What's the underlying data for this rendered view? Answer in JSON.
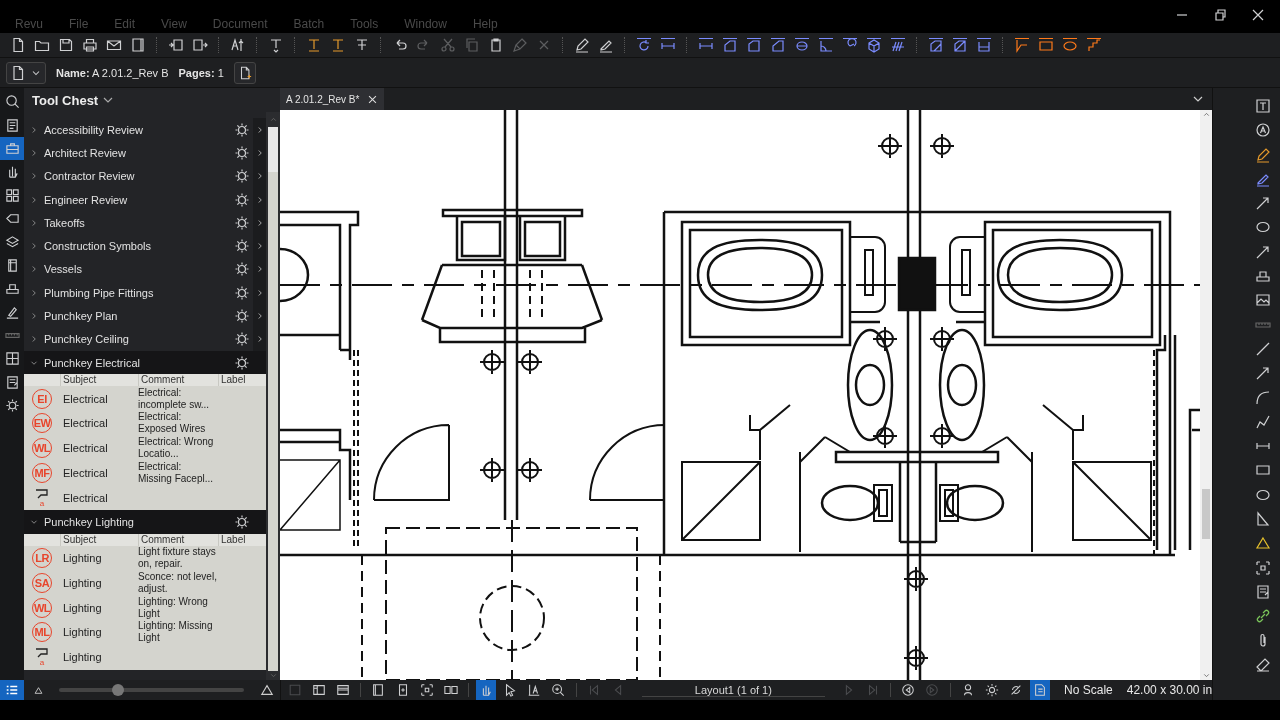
{
  "menu": [
    "Revu",
    "File",
    "Edit",
    "View",
    "Document",
    "Batch",
    "Tools",
    "Window",
    "Help"
  ],
  "toolbar": [
    {
      "tools": [
        {
          "disabled": false
        },
        {
          "disabled": false
        },
        {
          "disabled": false
        },
        {
          "disabled": false
        },
        {
          "disabled": false
        },
        {
          "disabled": false
        }
      ]
    },
    {
      "tools": [
        {
          "disabled": false
        },
        {
          "disabled": false
        }
      ]
    },
    {
      "tools": [
        {
          "disabled": false
        }
      ]
    },
    {
      "tools": [
        {
          "disabled": false
        }
      ]
    },
    {
      "tools": [
        {
          "disabled": false
        },
        {
          "disabled": false
        },
        {
          "disabled": false
        }
      ]
    },
    {
      "tools": [
        {
          "disabled": false
        },
        {
          "disabled": true
        },
        {
          "disabled": true
        },
        {
          "disabled": true
        },
        {
          "disabled": false
        },
        {
          "disabled": true
        },
        {
          "disabled": true
        }
      ]
    },
    {
      "tools": [
        {
          "disabled": false
        },
        {
          "disabled": false
        }
      ]
    },
    {
      "tools": [
        {
          "disabled": false
        },
        {
          "disabled": false
        }
      ]
    },
    {
      "tools": [
        {
          "disabled": false
        },
        {
          "disabled": false
        },
        {
          "disabled": false
        },
        {
          "disabled": false
        },
        {
          "disabled": false
        },
        {
          "disabled": false
        },
        {
          "disabled": false
        },
        {
          "disabled": false
        },
        {
          "disabled": false
        }
      ]
    },
    {
      "tools": [
        {
          "disabled": false
        },
        {
          "disabled": false
        },
        {
          "disabled": false
        }
      ]
    },
    {
      "tools": [
        {
          "disabled": false
        },
        {
          "disabled": false
        },
        {
          "disabled": false
        },
        {
          "disabled": false
        }
      ]
    }
  ],
  "properties_bar": {
    "name_label": "Name:",
    "name": "A 2.01.2_Rev B",
    "pages_label": "Pages:",
    "pages": "1"
  },
  "left_rail": [
    {
      "selected": false
    },
    {
      "selected": false
    },
    {
      "selected": true
    },
    {
      "selected": false
    },
    {
      "selected": false
    },
    {
      "selected": false
    },
    {
      "selected": false
    },
    {
      "selected": false
    },
    {
      "selected": false
    },
    {
      "selected": false
    },
    {
      "selected": false
    },
    {
      "selected": false
    },
    {
      "selected": false
    },
    {
      "selected": false
    }
  ],
  "tool_chest": {
    "title": "Tool Chest",
    "collections": [
      {
        "name": "Accessibility Review",
        "expanded": false
      },
      {
        "name": "Architect Review",
        "expanded": false
      },
      {
        "name": "Contractor Review",
        "expanded": false
      },
      {
        "name": "Engineer Review",
        "expanded": false
      },
      {
        "name": "Takeoffs",
        "expanded": false
      },
      {
        "name": "Construction Symbols",
        "expanded": false
      },
      {
        "name": "Vessels",
        "expanded": false
      },
      {
        "name": "Plumbing Pipe Fittings",
        "expanded": false
      },
      {
        "name": "Punchkey Plan",
        "expanded": false
      },
      {
        "name": "Punchkey Ceiling",
        "expanded": false
      },
      {
        "name": "Punchkey Electrical",
        "expanded": true,
        "columns": [
          "Subject",
          "Comment",
          "Label"
        ],
        "tools": [
          {
            "kind": "stamp",
            "symbol": "EI",
            "subject": "Electrical",
            "comment": "Electrical: incomplete sw..."
          },
          {
            "kind": "stamp",
            "symbol": "EW",
            "subject": "Electrical",
            "comment": "Electrical: Exposed Wires"
          },
          {
            "kind": "stamp",
            "symbol": "WL",
            "subject": "Electrical",
            "comment": "Electrical: Wrong Locatio..."
          },
          {
            "kind": "stamp",
            "symbol": "MF",
            "subject": "Electrical",
            "comment": "Electrical: Missing Facepl..."
          },
          {
            "kind": "callout",
            "symbol": "a",
            "subject": "Electrical"
          }
        ]
      },
      {
        "name": "Punchkey Lighting",
        "expanded": true,
        "columns": [
          "Subject",
          "Comment",
          "Label"
        ],
        "tools": [
          {
            "kind": "stamp",
            "symbol": "LR",
            "subject": "Lighting",
            "comment": "Light fixture stays on, repair."
          },
          {
            "kind": "stamp",
            "symbol": "SA",
            "subject": "Lighting",
            "comment": "Sconce: not level, adjust."
          },
          {
            "kind": "stamp",
            "symbol": "WL",
            "subject": "Lighting",
            "comment": "Lighting:  Wrong Light"
          },
          {
            "kind": "stamp",
            "symbol": "ML",
            "subject": "Lighting",
            "comment": "Lighting: Missing Light"
          },
          {
            "kind": "callout",
            "symbol": "a",
            "subject": "Lighting"
          }
        ]
      }
    ]
  },
  "document_tab": {
    "title": "A 2.01.2_Rev B*"
  },
  "zoom_slider": {
    "level": 0.32
  },
  "bottom_tools": [
    {
      "selected": false,
      "disabled": true
    },
    {
      "selected": false,
      "disabled": false
    },
    {
      "selected": false,
      "disabled": false
    },
    {
      "selected": false,
      "disabled": false
    },
    {
      "selected": false,
      "disabled": false
    },
    {
      "selected": false,
      "disabled": false
    },
    {
      "selected": false,
      "disabled": false
    },
    {
      "selected": true,
      "disabled": false
    },
    {
      "selected": false,
      "disabled": false
    },
    {
      "selected": false,
      "disabled": false
    },
    {
      "selected": false,
      "disabled": false
    },
    {
      "selected": false,
      "disabled": true
    },
    {
      "selected": false,
      "disabled": true
    }
  ],
  "page_navigation": {
    "page_label": "Layout1 (1 of 1)"
  },
  "nav_tools": [
    {
      "selected": false,
      "disabled": true
    },
    {
      "selected": false,
      "disabled": true
    },
    {
      "selected": false,
      "disabled": false
    },
    {
      "selected": false,
      "disabled": true
    },
    {
      "selected": false,
      "disabled": false
    },
    {
      "selected": false,
      "disabled": false
    },
    {
      "selected": false,
      "disabled": false
    },
    {
      "selected": true,
      "disabled": false
    }
  ],
  "status": {
    "scale": "No Scale",
    "size": "42.00 x 30.00 in"
  }
}
